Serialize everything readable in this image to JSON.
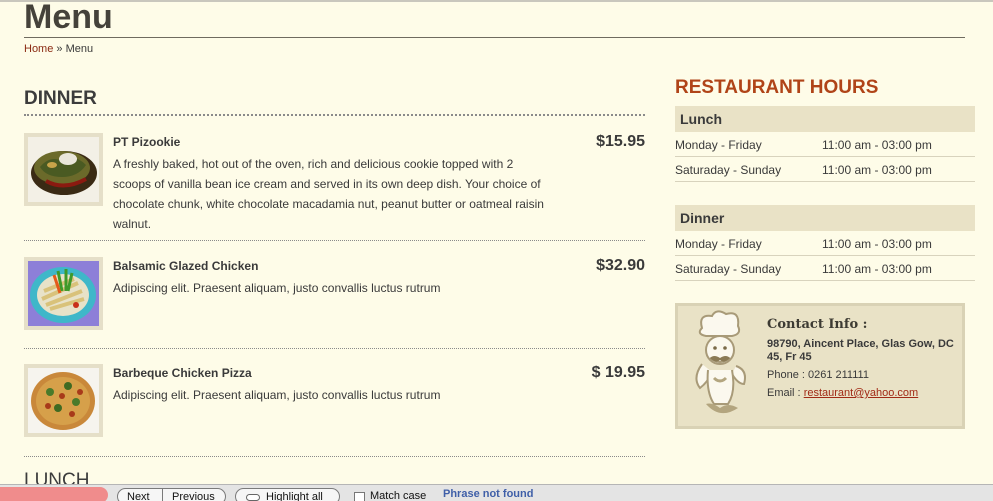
{
  "page": {
    "title": "Menu",
    "breadcrumb": {
      "home": "Home",
      "separator": "»",
      "current": "Menu"
    }
  },
  "menu": {
    "section_title": "DINNER",
    "next_section_title": "LUNCH",
    "items": [
      {
        "name": "PT Pizookie",
        "price": "$15.95",
        "description": "A freshly baked, hot out of the oven, rich and delicious cookie topped with 2 scoops of vanilla bean ice cream and served in its own deep dish. Your choice of chocolate chunk, white chocolate macadamia nut, peanut butter or oatmeal raisin walnut.",
        "image": "pizookie-dessert-photo"
      },
      {
        "name": "Balsamic Glazed Chicken",
        "price": "$32.90",
        "description": "Adipiscing elit. Praesent aliquam,  justo convallis luctus rutrum",
        "image": "pasta-plate-photo"
      },
      {
        "name": "Barbeque Chicken Pizza",
        "price": "$ 19.95",
        "description": "Adipiscing elit. Praesent aliquam, justo convallis luctus rutrum",
        "image": "pizza-photo"
      }
    ]
  },
  "hours": {
    "title": "RESTAURANT HOURS",
    "lunch": {
      "label": "Lunch",
      "rows": [
        {
          "day": "Monday - Friday",
          "time": "11:00 am - 03:00 pm"
        },
        {
          "day": "Saturaday - Sunday",
          "time": "11:00 am - 03:00 pm"
        }
      ]
    },
    "dinner": {
      "label": "Dinner",
      "rows": [
        {
          "day": "Monday - Friday",
          "time": "11:00 am - 03:00 pm"
        },
        {
          "day": "Saturaday - Sunday",
          "time": "11:00 am - 03:00 pm"
        }
      ]
    }
  },
  "contact": {
    "title": "Contact Info :",
    "address": "98790, Aincent Place, Glas Gow, DC 45, Fr 45",
    "phone_label": "Phone : ",
    "phone": "0261 211111",
    "email_label": "Email : ",
    "email": "restaurant@yahoo.com",
    "image": "chef-icon"
  },
  "findbar": {
    "next": "Next",
    "previous": "Previous",
    "highlight_all": "Highlight all",
    "match_case": "Match case",
    "status": "Phrase not found"
  },
  "colors": {
    "background": "#fefce8",
    "accent": "#b04418",
    "link": "#8b2a12",
    "panel": "#e9e2c6",
    "find_error": "#f08c8c",
    "find_status": "#3f5fa8"
  }
}
